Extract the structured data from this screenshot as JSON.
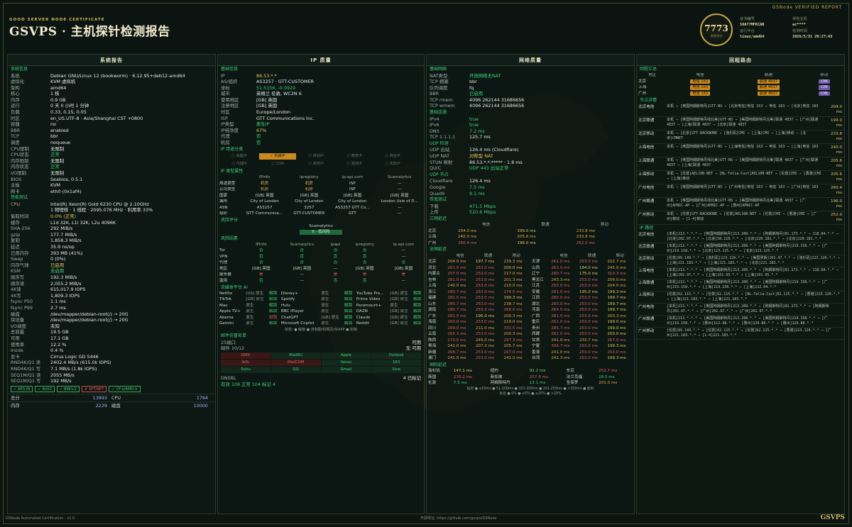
{
  "header": {
    "cert_line": "GOOD SERVER NODE CERTIFICATE",
    "title": "GSVPS · 主机探针检测报告",
    "report_tag": "GSNode VERIFIED REPORT",
    "score": "7773",
    "score_label": "综合评分",
    "meta_left": [
      {
        "k": "证书编号",
        "v": "58A77MFKCAB"
      },
      {
        "k": "运行平台",
        "v": "linux/amd64"
      }
    ],
    "meta_right": [
      {
        "k": "受检主机",
        "v": "ac****"
      },
      {
        "k": "检测时间",
        "v": "2026/5/31 20:27:43"
      }
    ]
  },
  "system": {
    "title": "系统报告",
    "sec_info": "系统信息",
    "rows": [
      {
        "k": "系统",
        "v": "Debian GNU/Linux 12 (bookworm) · 6.12.95+deb12-amd64"
      },
      {
        "k": "虚拟化",
        "v": "KVM 虚拟机"
      },
      {
        "k": "架构",
        "v": "amd64"
      },
      {
        "k": "核心",
        "v": "1 核"
      },
      {
        "k": "内存",
        "v": "0.9 GB"
      },
      {
        "k": "运行",
        "v": "0 天 0 小时 1 分钟"
      },
      {
        "k": "负载",
        "v": "0.33, 0.15, 0.05"
      },
      {
        "k": "时区",
        "v": "en_US.UTF-8 · Asia/Shanghai CST +0800"
      },
      {
        "k": "容器",
        "v": "no"
      },
      {
        "k": "BBR",
        "v": "enabled"
      },
      {
        "k": "TCP",
        "v": "bbr"
      },
      {
        "k": "调度",
        "v": "noqueue"
      },
      {
        "k": "CPU限制",
        "v": "无限制"
      },
      {
        "k": "CPU状态",
        "v": "正常",
        "c": "g"
      },
      {
        "k": "内存限制",
        "v": "无限制"
      },
      {
        "k": "内存状态",
        "v": "正常",
        "c": "g"
      },
      {
        "k": "I/O限制",
        "v": "无限制"
      },
      {
        "k": "BIOS",
        "v": "Seabios, 0.5.1"
      },
      {
        "k": "主板",
        "v": "KVM"
      },
      {
        "k": "网卡",
        "v": "eth0 (0x1af4)"
      }
    ],
    "sec_perf": "性能测试",
    "perf": [
      {
        "k": "CPU",
        "v": "Intel(R) Xeon(R) Gold 6230 CPU @ 2.10GHz"
      },
      {
        "k": "",
        "v": "1 物理核 · 1 线程 · 2095.076 MHz · 利用率 33%"
      },
      {
        "k": "偷取时间",
        "v": "0.0% (正常)",
        "c": "y"
      },
      {
        "k": "缓存",
        "v": "L1d 32K, L1i 32K, L2u 4096K"
      },
      {
        "k": "SHA-256",
        "v": "292 MiB/s"
      },
      {
        "k": "gzip",
        "v": "177.7 MiB/s"
      },
      {
        "k": "复制",
        "v": "1,858.3 MiB/s"
      },
      {
        "k": "延迟",
        "v": "35.9 ns/op"
      },
      {
        "k": "已用内存",
        "v": "393 MB (41%)"
      },
      {
        "k": "Swap",
        "v": "0 (0%)"
      },
      {
        "k": "内存气球",
        "v": "已启用",
        "c": "y"
      },
      {
        "k": "KSM",
        "v": "未启用",
        "c": "g"
      },
      {
        "k": "顺序写",
        "v": "192.3 MiB/s"
      },
      {
        "k": "顺序读",
        "v": "2,055.2 MiB/s"
      },
      {
        "k": "4K读",
        "v": "615,017.9 IOPS"
      },
      {
        "k": "4K写",
        "v": "1,809.3 IOPS"
      },
      {
        "k": "fsync P50",
        "v": "1.1 ms"
      },
      {
        "k": "fsync P99",
        "v": "2.7 ms"
      },
      {
        "k": "磁盘",
        "v": "/dev/mapper/debian-root(/) → 20G"
      },
      {
        "k": "块设备",
        "v": "/dev/mapper/debian-root(/) → 20G"
      },
      {
        "k": "I/O调度",
        "v": "未知"
      },
      {
        "k": "总容量",
        "v": "19.5 GB"
      },
      {
        "k": "可用",
        "v": "17.1 GB"
      },
      {
        "k": "使用率",
        "v": "12.2 %"
      },
      {
        "k": "Inode",
        "v": "0.4 %"
      },
      {
        "k": "显卡",
        "v": "Cirrus Logic GD 5446"
      },
      {
        "k": "RND4K/Q1 读",
        "v": "2402.4 MB/s (615.0k IOPS)"
      },
      {
        "k": "RND4K/Q1 写",
        "v": "7.1 MB/s (1.8k IOPS)"
      },
      {
        "k": "SEQ1M/Q1 读",
        "v": "2055 MB/s"
      },
      {
        "k": "SEQ1M/Q1 写",
        "v": "192 MB/s"
      }
    ],
    "flags": [
      {
        "t": "✓ AES-NI",
        "bad": false
      },
      {
        "t": "✓ AVX2",
        "bad": false
      },
      {
        "t": "✓ BMI1/2",
        "bad": false
      },
      {
        "t": "✗ SPT/NPT",
        "bad": true
      },
      {
        "t": "✓ VT-x/AMD-V",
        "bad": false
      }
    ],
    "summary": [
      {
        "a": "总分",
        "an": "13993",
        "b": "CPU",
        "bn": "1764"
      },
      {
        "a": "内存",
        "an": "2229",
        "b": "磁盘",
        "bn": "10000"
      }
    ]
  },
  "ip": {
    "title": "IP 质量",
    "sec_basic": "基础信息",
    "rows": [
      {
        "k": "IP",
        "v": "86.53.*.*",
        "c": "y"
      },
      {
        "k": "AS/组织",
        "v": "AS3257 · GTT-CUSTOMER"
      },
      {
        "k": "坐标",
        "v": "51.5156, -0.0920",
        "c": "g"
      },
      {
        "k": "城市",
        "v": "英格兰 伦敦, WC2N 6"
      },
      {
        "k": "使用地区",
        "v": "[GB] 英国"
      },
      {
        "k": "注册地区",
        "v": "[GB] 英国"
      },
      {
        "k": "时区",
        "v": "Europe/London"
      },
      {
        "k": "ISP",
        "v": "GTT Communications Inc."
      },
      {
        "k": "IP类型",
        "v": "原生IP",
        "c": "g"
      },
      {
        "k": "IP纯净度",
        "v": "67%",
        "c": "y"
      },
      {
        "k": "代理",
        "v": "否",
        "c": "g"
      },
      {
        "k": "机房",
        "v": "否",
        "c": "g"
      }
    ],
    "sec_pub": "IP 用途分类",
    "usage": [
      "○ 家庭IP",
      "✓ 机房IP",
      "○ 移动IP",
      "○ 教育IP",
      "○ 商业IP",
      "○ 代理IP",
      "○ CDN",
      "○ 政府IP",
      "○ 其他IP",
      "○ 未知IP"
    ],
    "sec_type": "IP 类型属性",
    "type_head": [
      "",
      "IPinfo",
      "ipregistry",
      "ip-api.com",
      "Scamalytics"
    ],
    "type_rows": [
      [
        "用途类型",
        "机房",
        "机房",
        "ISP",
        "—"
      ],
      [
        "公司类型",
        "机房",
        "机房",
        "ISP",
        "—"
      ],
      [
        "国家",
        "[GB] 英国",
        "[GB] 英国",
        "[GB] 英国",
        "[GB] 英国"
      ],
      [
        "城市",
        "City of London",
        "City of London",
        "City of London",
        "London (Isle of D..."
      ],
      [
        "ASN",
        "AS3257",
        "3257",
        "AS3257 GTT Co...",
        "—"
      ],
      [
        "组织",
        "GTT Communica...",
        "GTT-CUSTOMER",
        "GTT",
        "—"
      ]
    ],
    "sec_risk": "风险评分",
    "scam_label": "Scamalytics",
    "scam_value": "9 · 低风险",
    "sec_fac": "风险因素",
    "fac_head": [
      "",
      "IPinfo",
      "Scamalytics",
      "ipapi",
      "ipregistry",
      "ip-api.com"
    ],
    "fac_rows": [
      [
        "Tor",
        "否",
        "否",
        "否",
        "否",
        "—"
      ],
      [
        "VPN",
        "否",
        "否",
        "否",
        "否",
        "—"
      ],
      [
        "代理",
        "否",
        "否",
        "否",
        "否",
        "否"
      ],
      [
        "地区",
        "[GB] 英国",
        "[GB] 英国",
        "—",
        "[GB] 英国",
        "[GB] 英国"
      ],
      [
        "服务器",
        "是",
        "—",
        "是",
        "是",
        "是"
      ],
      [
        "滥用",
        "否",
        "—",
        "否",
        "否",
        "—"
      ]
    ],
    "sec_stream": "流媒体平台 AI",
    "stream": [
      [
        "Netflix",
        "[US] 原生",
        "解锁",
        "Disney+",
        "原生",
        "解锁",
        "YouTube Pre...",
        "[GB] 原生",
        "解锁"
      ],
      [
        "TikTok",
        "[GB] 原生",
        "解锁",
        "Spotify",
        "原生",
        "解锁",
        "Prime Video",
        "[GB] 原生",
        "解锁"
      ],
      [
        "Max",
        "原生",
        "解锁",
        "Hulu",
        "原生",
        "解锁",
        "Paramount+",
        "原生",
        "解锁"
      ],
      [
        "Apple TV+",
        "原生",
        "解锁",
        "BBC iPlayer",
        "原生",
        "解锁",
        "DAZN",
        "[GB] 原生",
        "解锁"
      ],
      [
        "Abema",
        "原生",
        "封锁",
        "ChatGPT",
        "[GB] 原生",
        "解锁",
        "Claude",
        "[GB] 原生",
        "解锁"
      ],
      [
        "Gemini",
        "原生",
        "解锁",
        "Microsoft Copilot",
        "原生",
        "解锁",
        "Reddit",
        "[GB] 原生",
        "解锁"
      ]
    ],
    "stream_legend": "状态: ● 解锁  ● 自制剧/仅网页/仅APP  ● 封锁",
    "sec_mail": "邮件仿冒名单",
    "mail_port": "25端口",
    "mail_port_val": "可用",
    "mail_black": "邮件 10/12",
    "mail_black_val": "无 可用",
    "mail_grid": [
      "GMX",
      "MailRU",
      "Apple",
      "Outlook",
      "AOL",
      "MailCOM",
      "Yahoo",
      "163",
      "Sohu",
      "QQ",
      "Gmail",
      "Sina"
    ],
    "dnsbl": "DNSBL",
    "dnsbl_right": "4 已标记",
    "dnsbl_stats": "有效 108   正常 104   标记 4"
  },
  "net": {
    "title": "网络质量",
    "sec_base": "基础网络",
    "rows": [
      {
        "k": "NAT类型",
        "v": "开放网络无NAT",
        "c": "g"
      },
      {
        "k": "TCP 拥塞",
        "v": "bbr"
      },
      {
        "k": "队列调度",
        "v": "fq"
      },
      {
        "k": "BBR",
        "v": "已启用",
        "c": "g"
      },
      {
        "k": "TCP rmem",
        "v": "4096 262144 31686656"
      },
      {
        "k": "TCP wmem",
        "v": "4096 262144 31686656"
      }
    ],
    "sec_disp": "基础连通",
    "conn": [
      {
        "k": "IPv4",
        "v": "true",
        "c": "g"
      },
      {
        "k": "IPv6",
        "v": "true",
        "c": "g"
      },
      {
        "k": "DNS",
        "v": "7.2 ms",
        "c": "g"
      },
      {
        "k": "TCP 1.1.1.1",
        "v": "125.7 ms"
      }
    ],
    "sec_udp": "UDP 检测",
    "udp": [
      {
        "k": "UDP 出站",
        "v": "126.4 ms (Cloudflare)"
      },
      {
        "k": "UDP NAT",
        "v": "对称型 NAT",
        "c": "y"
      },
      {
        "k": "STUN 映射",
        "v": "86.53.*.*:***** · 1.8 ms"
      },
      {
        "k": "QUIC",
        "v": "UDP 443 出站正常",
        "c": "g"
      }
    ],
    "sec_udp2": "UDP 节点",
    "udp2": [
      {
        "k": "Cloudflare",
        "v": "126.4 ms"
      },
      {
        "k": "Google",
        "v": "7.5 ms",
        "c": "g"
      },
      {
        "k": "Quad9",
        "v": "9.1 ms",
        "c": "g"
      }
    ],
    "sec_speed": "带宽测试",
    "speed": [
      {
        "k": "下载",
        "v": "471.5 Mbps",
        "c": "g"
      },
      {
        "k": "上传",
        "v": "520.6 Mbps",
        "c": "g"
      }
    ],
    "sec_three": "三网延迟",
    "three_head": [
      "",
      "电信",
      "联通",
      "移动"
    ],
    "three_rows": [
      [
        "北京",
        "204.0 ms",
        "199.0 ms",
        "233.8 ms"
      ],
      [
        "上海",
        "240.0 ms",
        "205.6 ms",
        "233.8 ms"
      ],
      [
        "广州",
        "260.4 ms",
        "196.0 ms",
        "252.0 ms"
      ]
    ],
    "sec_prov": "全国延迟",
    "prov_head": [
      "",
      "电信",
      "联通",
      "移动",
      "",
      "电信",
      "联通",
      "移动"
    ],
    "prov_rows": [
      [
        "北京",
        "204.0 ms",
        "197.7 ms",
        "239.3 ms",
        "天津",
        "261.0 ms",
        "253.0 ms",
        "202.7 ms"
      ],
      [
        "河北",
        "261.0 ms",
        "253.0 ms",
        "200.0 ms",
        "山西",
        "263.0 ms",
        "184.0 ms",
        "245.0 ms"
      ],
      [
        "内蒙古",
        "257.0 ms",
        "253.0 ms",
        "217.0 ms",
        "辽宁",
        "280.7 ms",
        "175.0 ms",
        "310.3 ms"
      ],
      [
        "吉林",
        "281.0 ms",
        "253.0 ms",
        "201.3 ms",
        "黑龙江",
        "243.3 ms",
        "253.0 ms",
        "206.0 ms"
      ],
      [
        "上海",
        "240.0 ms",
        "253.0 ms",
        "210.0 ms",
        "江苏",
        "255.0 ms",
        "253.0 ms",
        "204.0 ms"
      ],
      [
        "浙江",
        "280.7 ms",
        "253.0 ms",
        "274.0 ms",
        "安徽",
        "281.0 ms",
        "195.0 ms",
        "199.3 ms"
      ],
      [
        "福建",
        "281.0 ms",
        "253.0 ms",
        "199.3 ms",
        "江西",
        "280.0 ms",
        "253.0 ms",
        "199.7 ms"
      ],
      [
        "山东",
        "280.7 ms",
        "253.0 ms",
        "238.7 ms",
        "湖北",
        "260.0 ms",
        "253.0 ms",
        "199.7 ms"
      ],
      [
        "湖南",
        "280.7 ms",
        "253.3 ms",
        "268.0 ms",
        "河南",
        "264.5 ms",
        "253.0 ms",
        "199.7 ms"
      ],
      [
        "广东",
        "281.0 ms",
        "196.0 ms",
        "200.3 ms",
        "广西",
        "281.0 ms",
        "253.0 ms",
        "200.3 ms"
      ],
      [
        "海南",
        "260.0 ms",
        "253.0 ms",
        "219.0 ms",
        "重庆",
        "261.0 ms",
        "253.0 ms",
        "199.0 ms"
      ],
      [
        "四川",
        "269.0 ms",
        "211.0 ms",
        "333.5 ms",
        "贵州",
        "285.7 ms",
        "253.0 ms",
        "199.0 ms"
      ],
      [
        "云南",
        "265.3 ms",
        "253.0 ms",
        "200.3 ms",
        "西藏",
        "261.0 ms",
        "253.0 ms",
        "200.0 ms"
      ],
      [
        "陕西",
        "273.0 ms",
        "245.0 ms",
        "297.3 ms",
        "甘肃",
        "241.0 ms",
        "233.7 ms",
        "267.0 ms"
      ],
      [
        "青海",
        "241.0 ms",
        "207.3 ms",
        "205.7 ms",
        "宁夏",
        "306.7 ms",
        "253.0 ms",
        "199.3 ms"
      ],
      [
        "新疆",
        "268.7 ms",
        "253.0 ms",
        "267.0 ms",
        "香港",
        "241.0 ms",
        "253.0 ms",
        "253.0 ms"
      ],
      [
        "澳门",
        "241.0 ms",
        "253.0 ms",
        "241.0 ms",
        "台湾",
        "241.3 ms",
        "253.0 ms",
        "199.3 ms"
      ]
    ],
    "sec_intl": "国际延迟",
    "intl": [
      [
        "洛杉矶",
        "147.1 ms",
        "纽约",
        "92.2 ms",
        "东京",
        "252.7 ms"
      ],
      [
        "韩国",
        "276.2 ms",
        "新加坡",
        "257.8 ms",
        "法兰克福",
        "18.5 ms"
      ],
      [
        "伦敦",
        "7.5 ms",
        "阿姆斯特丹",
        "13.1 ms",
        "圣保罗",
        "201.0 ms"
      ]
    ],
    "legend1": "延迟  ● ≤50ms  ● 51-100ms  ● 101-200ms  ● 201-250ms  ● >250ms  ● 超时",
    "legend2": "丢包  ● 0%  ● ≤5%  ● ≤20%  ● >20%"
  },
  "route": {
    "title": "回程路由",
    "sec_summary": "回程汇总",
    "sum_head": [
      "地区",
      "电信",
      "联通",
      "移动"
    ],
    "sum_rows": [
      [
        "北京",
        "电信 163",
        "联通 4837",
        "CMI"
      ],
      [
        "上海",
        "电信 163",
        "联通 4837",
        "CMI"
      ],
      [
        "广州",
        "电信 163",
        "联通 4837",
        "CMI"
      ]
    ],
    "sec_detail": "节点详情",
    "detail_head": [
      "节点",
      "路线图",
      "延迟"
    ],
    "detail_rows": [
      {
        "n": "北京电信",
        "p": "本机 → [英国阿姆斯特丹]GTT-NS → [北京电信]电信 163 → 电信 163 → [北京]电信 163",
        "t": "204.0 ms"
      },
      {
        "n": "北京联通",
        "p": "本机 → [英国阿姆斯特丹线北美]GTT-NS → [美国阿姆斯特丹北美]联通 4837 → [广州]联通 4837 → [上海]联通 4837 → [北京]联通 4837",
        "t": "199.0 ms"
      },
      {
        "n": "北京移动",
        "p": "本机 → [北京]GTT-BACKBONE → [洛杉矶]CMI → [上海]CMI → [上海]移动 → [北京]CMNET",
        "t": "233.8 ms"
      },
      {
        "n": "上海电信",
        "p": "本机 → [英国阿姆斯特丹]GTT-NS → [上海电信]电信 163 → 电信 163 → [上海]电信 163",
        "t": "240.0 ms"
      },
      {
        "n": "上海联通",
        "p": "本机 → [英国阿姆斯特丹线北美]GTT-NS → [美国阿姆斯特丹北美]联通 4837 → [广州]联通 4837 → [上海]联通 4837",
        "t": "205.6 ms"
      },
      {
        "n": "上海移动",
        "p": "本机 → [伦敦]AEL10B-NET → [NL-Telia-Cust]AEL10B-NET → [伦敦]CMI → [香港]CMI → [上海]移动",
        "t": "205.6 ms"
      },
      {
        "n": "广州电信",
        "p": "本机 → [英国阿姆斯特丹]GTT-NS → [广州电信]电信 163 → 电信 163 → [广州]电信 163",
        "t": "260.4 ms"
      },
      {
        "n": "广州联通",
        "p": "本机 → [英国阿姆斯特丹线北美]GTT-NS → [美国阿姆斯特丹北美]联通 4837 → [广州]APNIC-AP → [广州]APNIC-AP → [惠州]APNIC-AP",
        "t": "196.0 ms"
      },
      {
        "n": "广州移动",
        "p": "本机 → [伦敦]GTT-BACKBONE → [伦敦]AEL10B-NET → [伦敦]CMI → [香港]CMI → [广州]移动 → [1-4]移动",
        "t": "252.0 ms"
      }
    ],
    "sec_ip": "IP 路径",
    "ip_head": [
      "节点",
      "IP 路径"
    ],
    "ip_rows": [
      {
        "n": "北京电信",
        "p": "[本机]213.*.*.* → [英国阿姆斯特丹]213.200.*.* → [阿姆斯特丹]81.173.*.* → 118.84.*.* → [北京]202.97.*.* → [北京]58.110.*.* → [北京]220.181.*.* → [北京]220.181.*.*"
      },
      {
        "n": "北京联通",
        "p": "[本机]213.*.*.* → [美国阿姆斯特丹]213.200.*.* → [美国阿姆斯特丹]219.158.*.* → [广州]219.158.*.* → [北京]123.125.*.* → [北京]123.125.*.*"
      },
      {
        "n": "北京移动",
        "p": "[伦敦]89.149.*.* → [洛杉矶]223.120.*.* → [美国罗斯]101.47.*.* → [洛杉矶]223.120.*.* → [上海]221.183.*.* → [上海]221.183.*.* → [北京]221.183.*.*"
      },
      {
        "n": "上海电信",
        "p": "[本机]213.*.*.* → [英国阿姆斯特丹]213.200.*.* → [阿姆斯特丹]81.173.*.* → 118.84.*.* → [上海]202.97.*.* → [上海]101.95.*.* → [上海]101.95.*.*"
      },
      {
        "n": "上海联通",
        "p": "[本机]213.*.*.* → [美国阿姆斯特丹]213.200.*.* → [美国阿姆斯特丹]219.158.*.* → [广州]219.158.*.* → [上海]219.158.*.* → [上海]112.64.*.*"
      },
      {
        "n": "上海移动",
        "p": "[伦敦]62.115.*.* → [伦敦]62.115.*.* → [NL-Telia-Cust]62.115.*.* → [香港]223.120.*.* → [上海]221.183.*.* → [上海]221.183.*.*"
      },
      {
        "n": "广州电信",
        "p": "[本机]213.*.*.* → [英国阿姆斯特丹]213.200.*.* → [阿姆斯特丹]81.173.*.* → [阿姆斯特丹]202.97.*.* → [广州]202.97.*.* → [广州]202.97.*.*"
      },
      {
        "n": "广州联通",
        "p": "[本机]213.*.*.* → [美国阿姆斯特丹]213.200.*.* → [美国阿姆斯特丹]219.158.*.* → [广州]219.158.*.* → [惠州]112.98.*.* → [惠州]120.80.*.* → [惠州]120.80.*.*"
      },
      {
        "n": "广州移动",
        "p": "[伦敦]89.149.*.* → [伦敦]62.115.*.* → [伦敦]62.115.*.* → [香港]223.120.*.* → [广州]221.183.*.* → [1-4]221.183.*.*"
      }
    ]
  },
  "footer": {
    "left": "GSNode Automated Certification · v1.0",
    "center": "开源地址: https://github.com/gsvps/GSNode",
    "brand": "GSVPS"
  }
}
